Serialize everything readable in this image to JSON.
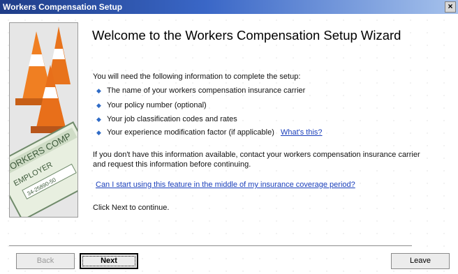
{
  "window": {
    "title": "Workers Compensation Setup"
  },
  "heading": "Welcome to the Workers Compensation Setup Wizard",
  "intro": "You will need the following information to complete the setup:",
  "bullets": [
    "The name of your workers compensation insurance carrier",
    "Your policy number (optional)",
    "Your job classification codes and rates",
    "Your experience modification factor (if applicable)"
  ],
  "whats_this_link": "What's this?",
  "info_line1": "If you don't have this information available, contact your workers compensation insurance carrier",
  "info_line2": "and request this information before continuing.",
  "coverage_link": "Can I start using this feature in the middle of my insurance coverage period?",
  "continue_text": "Click Next to continue.",
  "buttons": {
    "back": "Back",
    "next": "Next",
    "leave": "Leave"
  },
  "image_text": {
    "line1": "WORKERS COMP",
    "line2": "EMPLOYER",
    "line3": "34-25890-50"
  },
  "colors": {
    "title_bar": "#1f3d88",
    "link": "#1a3fbb",
    "bullet": "#2f6bc6",
    "cone": "#e8731c"
  }
}
